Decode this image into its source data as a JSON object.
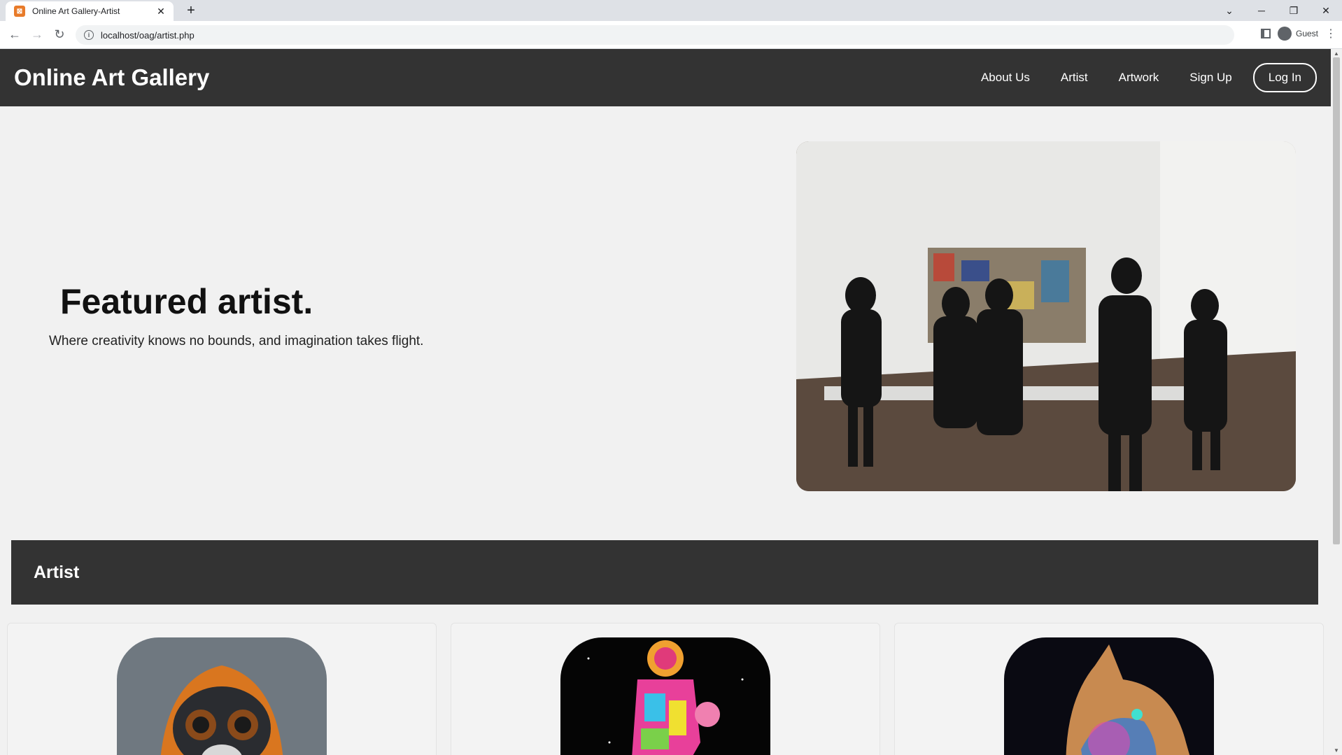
{
  "browser": {
    "tab_title": "Online Art Gallery-Artist",
    "url": "localhost/oag/artist.php",
    "profile": "Guest"
  },
  "site": {
    "brand": "Online Art Gallery",
    "nav": [
      "About Us",
      "Artist",
      "Artwork",
      "Sign Up"
    ],
    "login": "Log In"
  },
  "hero": {
    "title": "Featured artist.",
    "subtitle": "Where creativity knows no bounds, and imagination takes flight."
  },
  "section": {
    "title": "Artist"
  },
  "colors": {
    "nav_bg": "#333333",
    "page_bg": "#f1f1f1"
  },
  "icons": [
    "back-arrow-icon",
    "forward-arrow-icon",
    "reload-icon",
    "info-icon",
    "side-panel-icon",
    "profile-icon",
    "menu-kebab-icon",
    "close-icon",
    "new-tab-icon",
    "minimize-icon",
    "restore-icon",
    "dropdown-icon"
  ]
}
